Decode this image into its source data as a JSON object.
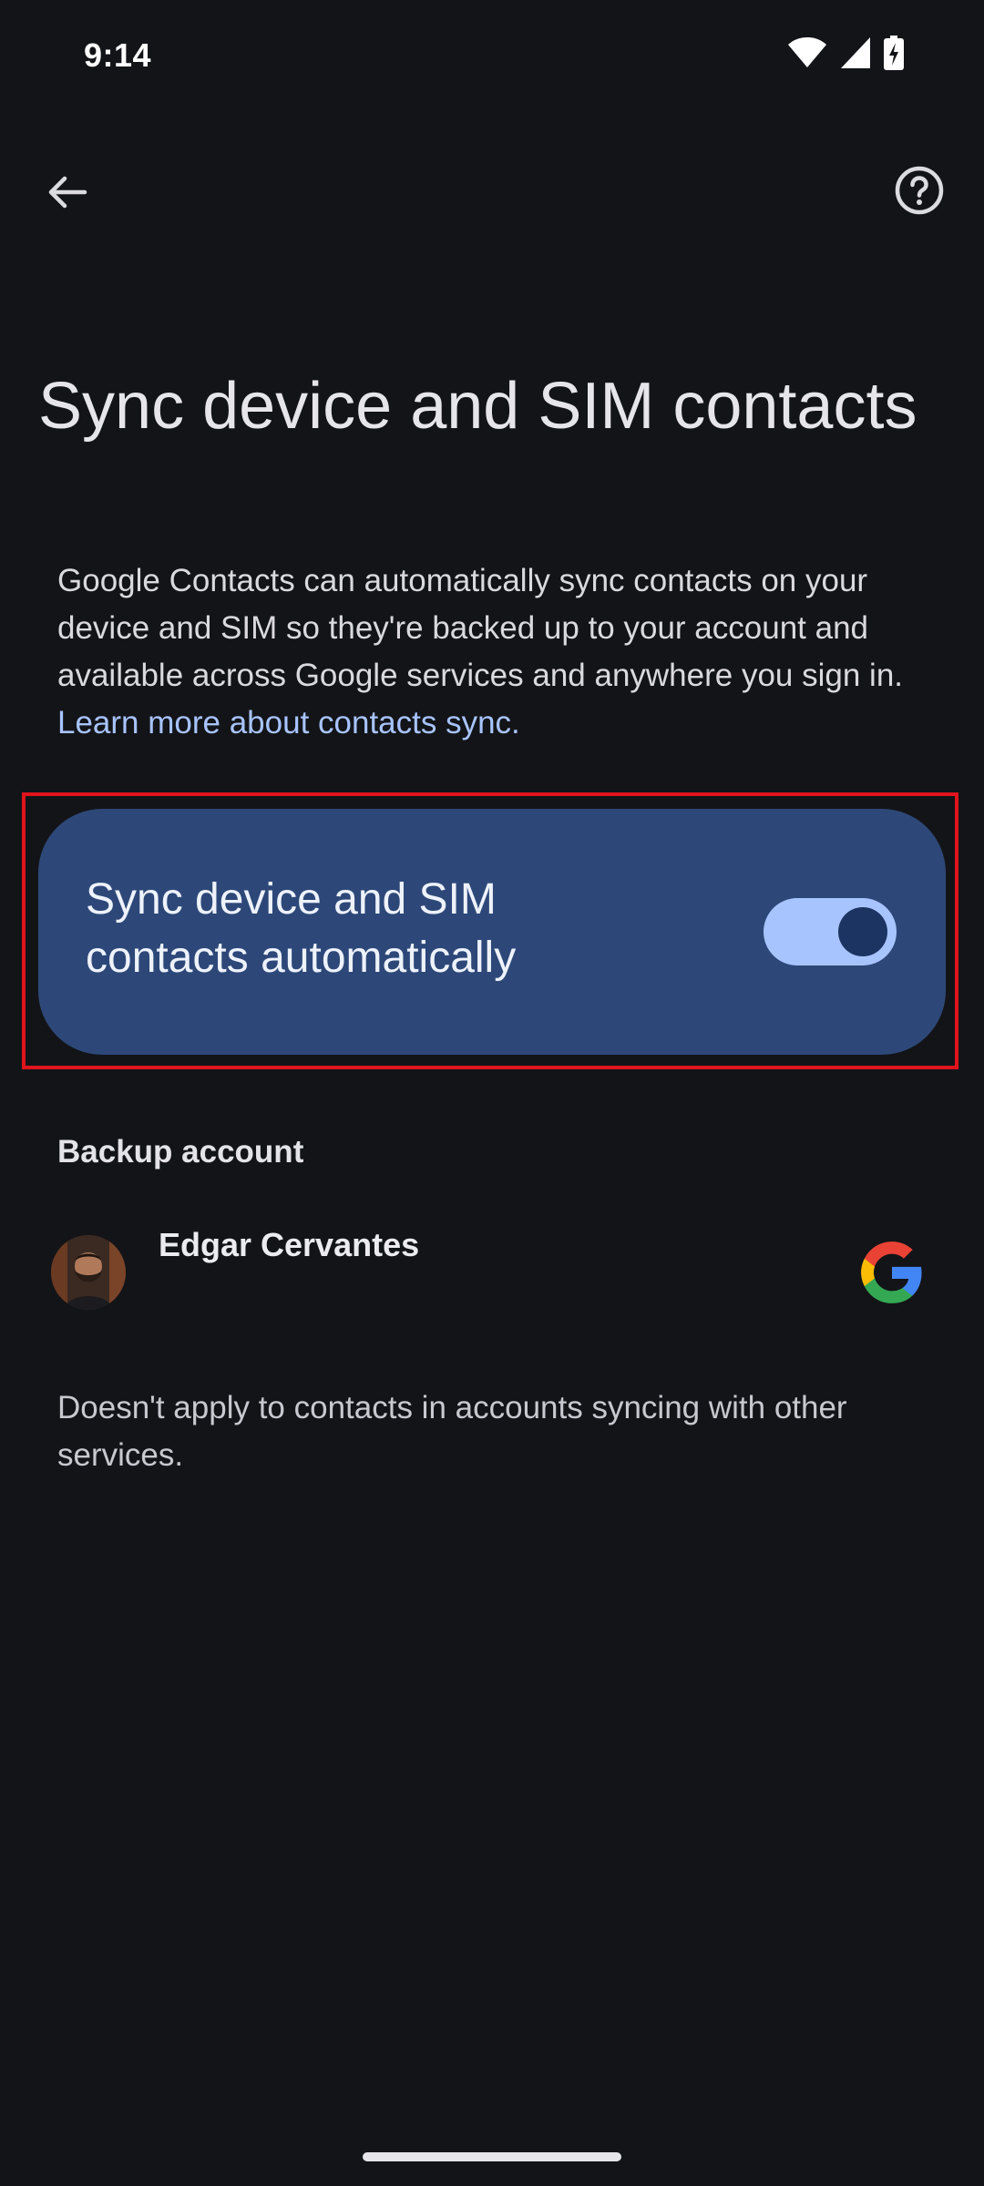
{
  "status_bar": {
    "time": "9:14",
    "icons": [
      "wifi-icon",
      "cellular-signal-icon",
      "battery-charging-icon"
    ]
  },
  "top_bar": {
    "back_icon": "arrow-back-icon",
    "help_icon": "help-circle-icon"
  },
  "page": {
    "title": "Sync device and SIM contacts",
    "description": "Google Contacts can automatically sync contacts on your device and SIM so they're backed up to your account and available across Google services and anywhere you sign in. ",
    "learn_more_link": "Learn more about contacts sync."
  },
  "sync_toggle": {
    "label": "Sync device and SIM contacts automatically",
    "enabled": true
  },
  "backup": {
    "section_title": "Backup account",
    "account_name": "Edgar Cervantes",
    "account_icon": "google-logo-icon"
  },
  "footnote": "Doesn't apply to contacts in accounts syncing with other services.",
  "colors": {
    "background": "#131418",
    "card": "#2d4878",
    "accent": "#a8c4ff",
    "highlight": "#e0141c"
  }
}
